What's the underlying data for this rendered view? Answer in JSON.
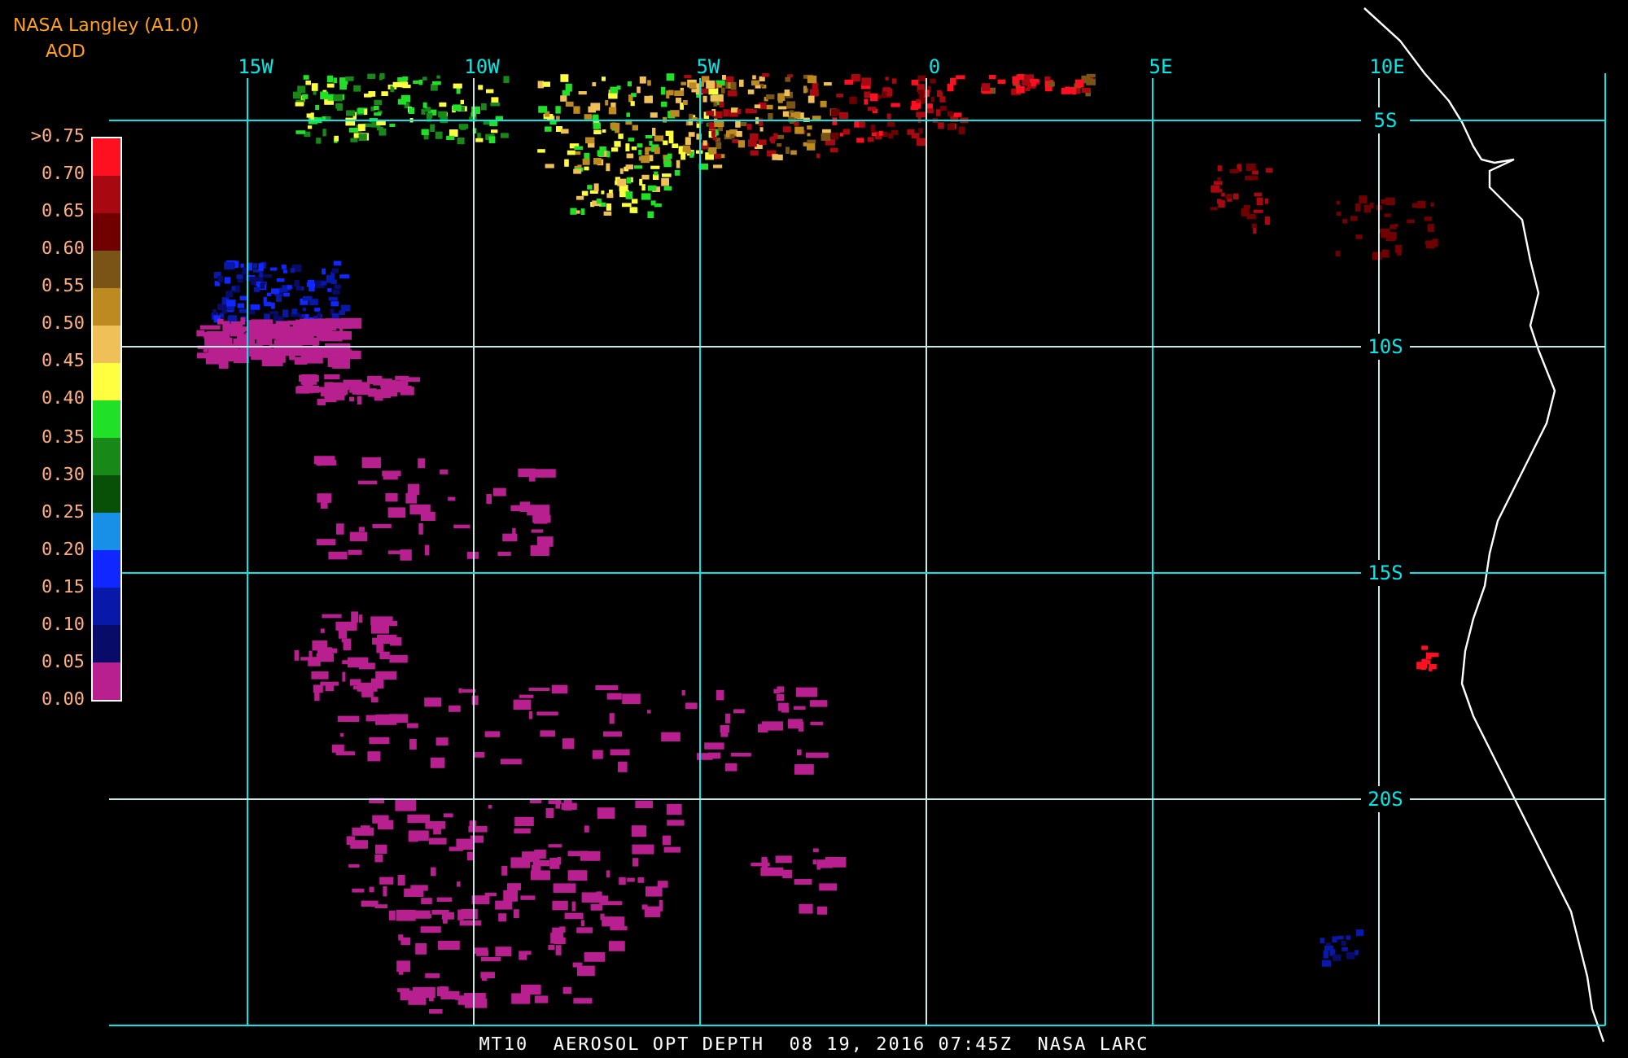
{
  "header": {
    "title": "NASA Langley (A1.0)",
    "unit": "AOD"
  },
  "legend": {
    "labels": [
      ">0.75",
      "0.70",
      "0.65",
      "0.60",
      "0.55",
      "0.50",
      "0.45",
      "0.40",
      "0.35",
      "0.30",
      "0.25",
      "0.20",
      "0.15",
      "0.10",
      "0.05",
      "0.00"
    ],
    "segments": [
      {
        "color": "#ff1020"
      },
      {
        "color": "#a80810"
      },
      {
        "color": "#700000"
      },
      {
        "color": "#7a5416"
      },
      {
        "color": "#bc8a20"
      },
      {
        "color": "#f0c058"
      },
      {
        "color": "#ffff40"
      },
      {
        "color": "#20e028"
      },
      {
        "color": "#188818"
      },
      {
        "color": "#085008"
      },
      {
        "color": "#1890e8"
      },
      {
        "color": "#1028ff"
      },
      {
        "color": "#0818a8"
      },
      {
        "color": "#080c68"
      },
      {
        "color": "#b82090"
      }
    ]
  },
  "map": {
    "longitude_labels": [
      "15W",
      "10W",
      "5W",
      "0",
      "5E",
      "10E"
    ],
    "latitude_labels": [
      "5S",
      "10S",
      "15S",
      "20S"
    ]
  },
  "footer": {
    "caption": "MT10  AEROSOL OPT DEPTH  08 19, 2016 07:45Z  NASA LARC"
  }
}
